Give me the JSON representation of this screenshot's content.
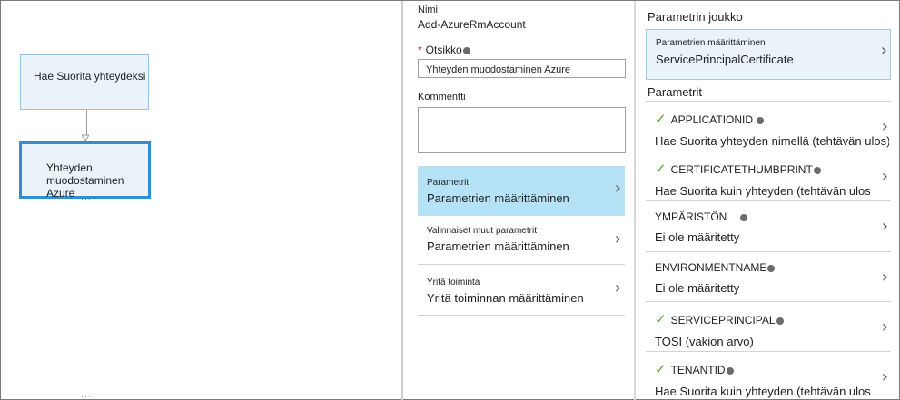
{
  "canvas": {
    "node1_label": "Hae Suorita yhteydeksi",
    "node2_label": "Yhteyden muodostaminen Azure"
  },
  "middle": {
    "nimi_label": "Nimi",
    "nimi_value": "Add-AzureRmAccount",
    "otsikko_required": "*",
    "otsikko_label": "Otsikko",
    "otsikko_value": "Yhteyden muodostaminen Azure",
    "kommentti_label": "Kommentti",
    "kommentti_value": "",
    "nav": [
      {
        "small": "Parametrit",
        "big": "Parametrien määrittäminen"
      },
      {
        "small": "Valinnaiset muut parametrit",
        "big": "Parametrien määrittäminen"
      },
      {
        "small": "Yritä toiminta",
        "big": "Yritä toiminnan määrittäminen"
      }
    ]
  },
  "right": {
    "joukko_title": "Parametrin joukko",
    "joukko_small": "Parametrien määrittäminen",
    "joukko_value": "ServicePrincipalCertificate",
    "parametrit_title": "Parametrit",
    "params": [
      {
        "name": "APPLICATIONID",
        "value": "Hae Suorita yhteyden nimellä (tehtävän ulos) h",
        "checked": true
      },
      {
        "name": "CERTIFICATETHUMBPRINT",
        "value": "Hae Suorita kuin yhteyden (tehtävän ulos",
        "checked": true
      },
      {
        "name": "YMPÄRISTÖN",
        "value": "Ei ole määritetty",
        "checked": false
      },
      {
        "name": "ENVIRONMENTNAME",
        "value": "Ei ole määritetty",
        "checked": false
      },
      {
        "name": "SERVICEPRINCIPAL",
        "value": "TOSI (vakion arvo)",
        "checked": true
      },
      {
        "name": "TENANTID",
        "value": "Hae Suorita kuin yhteyden (tehtävän ulos",
        "checked": true
      }
    ]
  },
  "icons": {
    "check": "check-icon",
    "chevron": "chevron-right-icon",
    "info": "info-icon"
  },
  "colors": {
    "selected_nav_bg": "#b5e3f5",
    "node_bg": "#eaf3fa",
    "selected_node_border": "#2f8fd6",
    "check": "#5aa02c"
  }
}
